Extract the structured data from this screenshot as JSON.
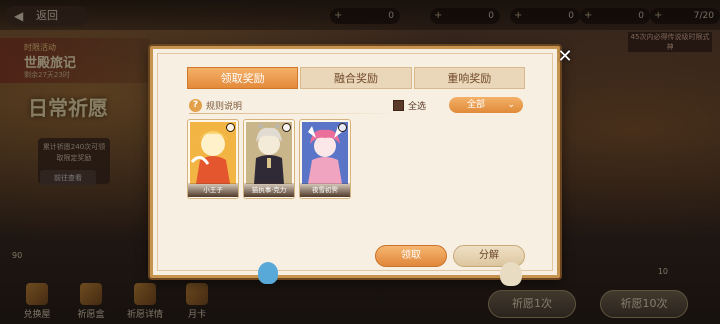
{
  "topbar": {
    "back_label": "返回",
    "resources": [
      "0",
      "0",
      "0",
      "0",
      "7/20"
    ]
  },
  "left_event": {
    "tag": "时限活动",
    "title": "世殿旅记",
    "time": "剩余27天23时"
  },
  "daily_title": "日常祈愿",
  "left_box_text": "累计祈愿240次可领取限定奖励",
  "left_box_button": "前往查看",
  "right_note": "45次内必得传说级时限式神",
  "bottom_nav": [
    {
      "label": "兑换屋",
      "icon": "shop-icon"
    },
    {
      "label": "祈愿盒",
      "icon": "box-icon"
    },
    {
      "label": "祈愿详情",
      "icon": "scroll-icon"
    },
    {
      "label": "月卡",
      "icon": "card-icon"
    }
  ],
  "counts": {
    "left": "90",
    "right": "10"
  },
  "pull_buttons": {
    "one": "祈愿1次",
    "ten": "祈愿10次"
  },
  "modal": {
    "tabs": [
      {
        "label": "领取奖励",
        "active": true
      },
      {
        "label": "融合奖励",
        "active": false
      },
      {
        "label": "重响奖励",
        "active": false
      }
    ],
    "rules_label": "规则说明",
    "select_all_label": "全选",
    "filter_value": "全部",
    "cards": [
      {
        "name": "小王子",
        "palette": "gold"
      },
      {
        "name": "猫执事·克力",
        "palette": "grey"
      },
      {
        "name": "夜雪初霁",
        "palette": "blue"
      }
    ],
    "claim_label": "领取",
    "split_label": "分解",
    "close_symbol": "✕"
  },
  "colors": {
    "accent": "#e38a3a",
    "panel": "#f7efe2",
    "frame": "#c6944f"
  }
}
